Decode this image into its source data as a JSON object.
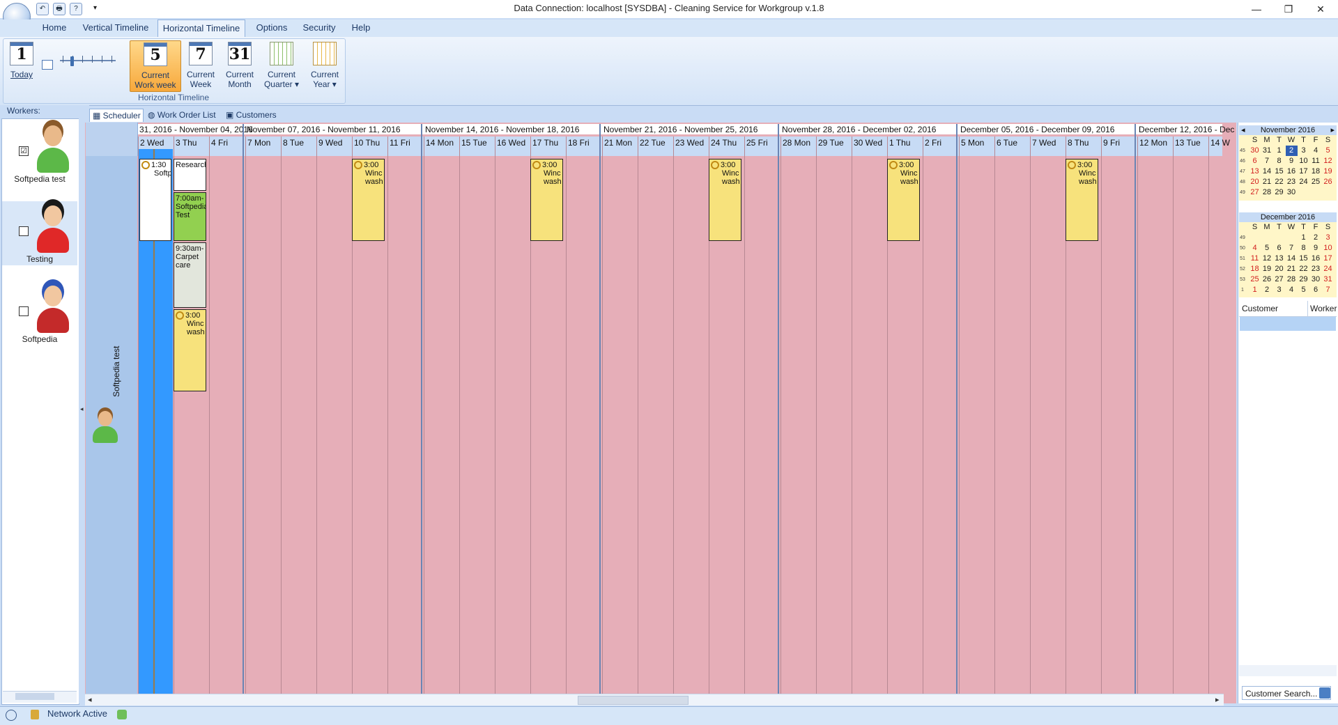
{
  "window": {
    "title": "Data Connection: localhost [SYSDBA] - Cleaning Service for Workgroup v.1.8",
    "controls": [
      "—",
      "❐",
      "✕"
    ]
  },
  "quick_access": [
    "↶",
    "🖶",
    "?",
    "▾"
  ],
  "ribbon": {
    "tabs": [
      "Home",
      "Vertical Timeline",
      "Horizontal Timeline",
      "Options",
      "Security",
      "Help"
    ],
    "active_tab": "Horizontal Timeline",
    "group_label": "Horizontal Timeline",
    "buttons": [
      {
        "icon_text": "1",
        "label1": "Today",
        "label2": ""
      },
      {
        "icon_text": "5",
        "label1": "Current",
        "label2": "Work week"
      },
      {
        "icon_text": "7",
        "label1": "Current",
        "label2": "Week"
      },
      {
        "icon_text": "31",
        "label1": "Current",
        "label2": "Month"
      },
      {
        "icon_text": "",
        "label1": "Current",
        "label2": "Quarter ▾"
      },
      {
        "icon_text": "",
        "label1": "Current",
        "label2": "Year ▾"
      }
    ]
  },
  "workers": {
    "header": "Workers:",
    "items": [
      {
        "name": "Softpedia test",
        "checked": "☑"
      },
      {
        "name": "Testing",
        "checked": ""
      },
      {
        "name": "Softpedia",
        "checked": ""
      }
    ]
  },
  "doc_tabs": [
    "Scheduler",
    "Work Order List",
    "Customers"
  ],
  "scheduler": {
    "resource": "Softpedia test",
    "weeks": [
      "31, 2016 - November 04, 2016",
      "November 07, 2016 - November 11, 2016",
      "November 14, 2016 - November 18, 2016",
      "November 21, 2016 - November 25, 2016",
      "November 28, 2016 - December 02, 2016",
      "December 05, 2016 - December 09, 2016",
      "December 12, 2016 - Dec"
    ],
    "days": [
      "2 Wed",
      "3 Thu",
      "4 Fri",
      "7 Mon",
      "8 Tue",
      "9 Wed",
      "10 Thu",
      "11 Fri",
      "14 Mon",
      "15 Tue",
      "16 Wed",
      "17 Thu",
      "18 Fri",
      "21 Mon",
      "22 Tue",
      "23 Wed",
      "24 Thu",
      "25 Fri",
      "28 Mon",
      "29 Tue",
      "30 Wed",
      "1 Thu",
      "2 Fri",
      "5 Mon",
      "6 Tue",
      "7 Wed",
      "8 Thu",
      "9 Fri",
      "12 Mon",
      "13 Tue",
      "14 W"
    ],
    "appointments": [
      {
        "line1": "1:30",
        "line2": "Softp",
        "line3": ""
      },
      {
        "line1": "Research",
        "line2": "",
        "line3": ""
      },
      {
        "line1": "7:00am-",
        "line2": "Softpedia",
        "line3": "Test"
      },
      {
        "line1": "9:30am-",
        "line2": "Carpet",
        "line3": "care"
      },
      {
        "line1": "3:00",
        "line2": "Winc",
        "line3": "wash"
      }
    ]
  },
  "mini_calendars": [
    {
      "title": "November 2016",
      "dow": [
        "S",
        "M",
        "T",
        "W",
        "T",
        "F",
        "S"
      ],
      "weeks": [
        "45",
        "46",
        "47",
        "48",
        "49"
      ],
      "rows": [
        [
          "30",
          "31",
          "1",
          "2",
          "3",
          "4",
          "5"
        ],
        [
          "6",
          "7",
          "8",
          "9",
          "10",
          "11",
          "12"
        ],
        [
          "13",
          "14",
          "15",
          "16",
          "17",
          "18",
          "19"
        ],
        [
          "20",
          "21",
          "22",
          "23",
          "24",
          "25",
          "26"
        ],
        [
          "27",
          "28",
          "29",
          "30",
          "",
          "",
          ""
        ]
      ]
    },
    {
      "title": "December 2016",
      "dow": [
        "S",
        "M",
        "T",
        "W",
        "T",
        "F",
        "S"
      ],
      "weeks": [
        "49",
        "50",
        "51",
        "52",
        "53",
        "1"
      ],
      "rows": [
        [
          "",
          "",
          "",
          "",
          "1",
          "2",
          "3"
        ],
        [
          "4",
          "5",
          "6",
          "7",
          "8",
          "9",
          "10"
        ],
        [
          "11",
          "12",
          "13",
          "14",
          "15",
          "16",
          "17"
        ],
        [
          "18",
          "19",
          "20",
          "21",
          "22",
          "23",
          "24"
        ],
        [
          "25",
          "26",
          "27",
          "28",
          "29",
          "30",
          "31"
        ],
        [
          "1",
          "2",
          "3",
          "4",
          "5",
          "6",
          "7"
        ]
      ]
    }
  ],
  "customer_grid": {
    "col1": "Customer",
    "col2": "Worker"
  },
  "customer_search": {
    "placeholder": "Customer Search..."
  },
  "status": {
    "network": "Network Active"
  },
  "colors": {
    "accent": "#3399ff",
    "slot": "#e6aeb8",
    "appt_yellow": "#f7e27c",
    "appt_green": "#92d050"
  }
}
